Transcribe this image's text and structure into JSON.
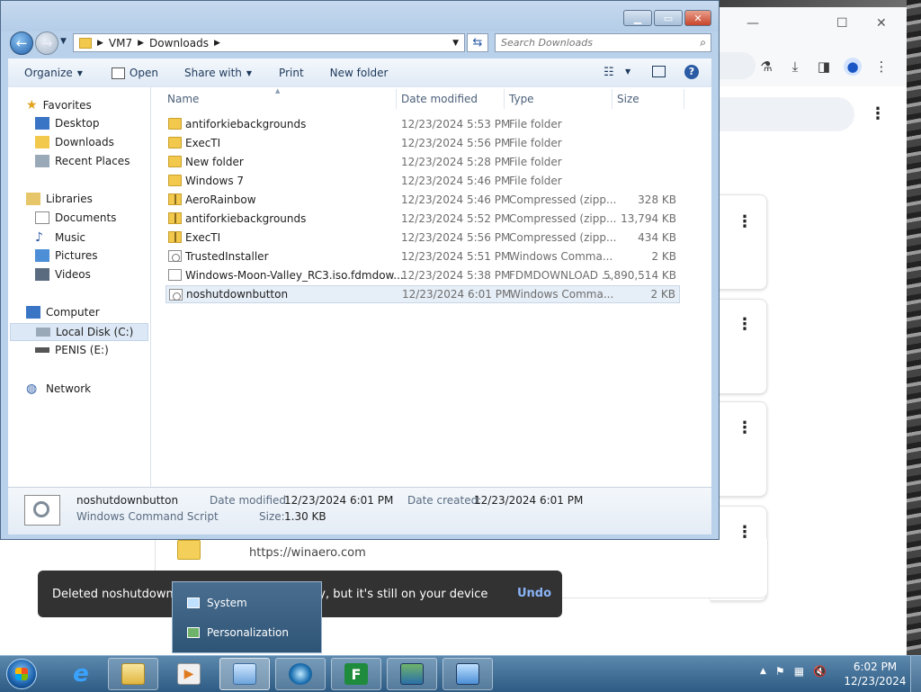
{
  "explorer": {
    "breadcrumb": [
      "VM7",
      "Downloads"
    ],
    "search_placeholder": "Search Downloads",
    "commands": {
      "organize": "Organize",
      "open": "Open",
      "share_with": "Share with",
      "print": "Print",
      "new_folder": "New folder"
    },
    "nav": {
      "favorites": "Favorites",
      "desktop": "Desktop",
      "downloads": "Downloads",
      "recent_places": "Recent Places",
      "libraries": "Libraries",
      "documents": "Documents",
      "music": "Music",
      "pictures": "Pictures",
      "videos": "Videos",
      "computer": "Computer",
      "local_disk": "Local Disk (C:)",
      "drive_e": "PENIS (E:)",
      "network": "Network"
    },
    "columns": {
      "name": "Name",
      "date": "Date modified",
      "type": "Type",
      "size": "Size"
    },
    "files": [
      {
        "name": "antiforkiebackgrounds",
        "date": "12/23/2024 5:53 PM",
        "type": "File folder",
        "size": "",
        "icon": "folder"
      },
      {
        "name": "ExecTI",
        "date": "12/23/2024 5:56 PM",
        "type": "File folder",
        "size": "",
        "icon": "folder"
      },
      {
        "name": "New folder",
        "date": "12/23/2024 5:28 PM",
        "type": "File folder",
        "size": "",
        "icon": "folder"
      },
      {
        "name": "Windows 7",
        "date": "12/23/2024 5:46 PM",
        "type": "File folder",
        "size": "",
        "icon": "folder"
      },
      {
        "name": "AeroRainbow",
        "date": "12/23/2024 5:46 PM",
        "type": "Compressed (zipp...",
        "size": "328 KB",
        "icon": "zip"
      },
      {
        "name": "antiforkiebackgrounds",
        "date": "12/23/2024 5:52 PM",
        "type": "Compressed (zipp...",
        "size": "13,794 KB",
        "icon": "zip"
      },
      {
        "name": "ExecTI",
        "date": "12/23/2024 5:56 PM",
        "type": "Compressed (zipp...",
        "size": "434 KB",
        "icon": "zip"
      },
      {
        "name": "TrustedInstaller",
        "date": "12/23/2024 5:51 PM",
        "type": "Windows Comma...",
        "size": "2 KB",
        "icon": "script"
      },
      {
        "name": "Windows-Moon-Valley_RC3.iso.fdmdow...",
        "date": "12/23/2024 5:38 PM",
        "type": "FDMDOWNLOAD ...",
        "size": "5,890,514 KB",
        "icon": "doc"
      },
      {
        "name": "noshutdownbutton",
        "date": "12/23/2024 6:01 PM",
        "type": "Windows Comma...",
        "size": "2 KB",
        "icon": "script",
        "selected": true
      }
    ],
    "details": {
      "name": "noshutdownbutton",
      "type": "Windows Command Script",
      "date_modified_label": "Date modified:",
      "date_modified": "12/23/2024 6:01 PM",
      "date_created_label": "Date created:",
      "date_created": "12/23/2024 6:01 PM",
      "size_label": "Size:",
      "size": "1.30 KB"
    }
  },
  "browser": {
    "url_text": "https://winaero.com"
  },
  "toast": {
    "message": "Deleted noshutdownbu",
    "message_tail": "ory, but it's still on your device",
    "action": "Undo"
  },
  "jumplist": {
    "items": [
      "System",
      "Personalization"
    ]
  },
  "taskbar": {
    "time": "6:02 PM",
    "date": "12/23/2024"
  },
  "colors": {
    "accent": "#2b5ba4",
    "toast_bg": "#323232",
    "undo": "#8ab4f8",
    "taskbar": "#3f6e96"
  }
}
